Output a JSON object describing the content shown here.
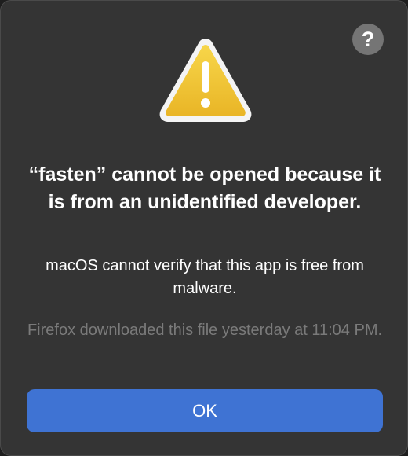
{
  "dialog": {
    "help_label": "?",
    "icon": "warning-triangle-icon",
    "title": "“fasten” cannot be opened because it is from an unidentified developer.",
    "message": "macOS cannot verify that this app is free from malware.",
    "info": "Firefox downloaded this file yesterday at 11:04 PM.",
    "ok_label": "OK"
  },
  "colors": {
    "background": "#343434",
    "button_accent": "#3f73d3",
    "warning_yellow": "#f2c230",
    "secondary_text": "#7a7a7a",
    "help_circle": "#757575"
  }
}
